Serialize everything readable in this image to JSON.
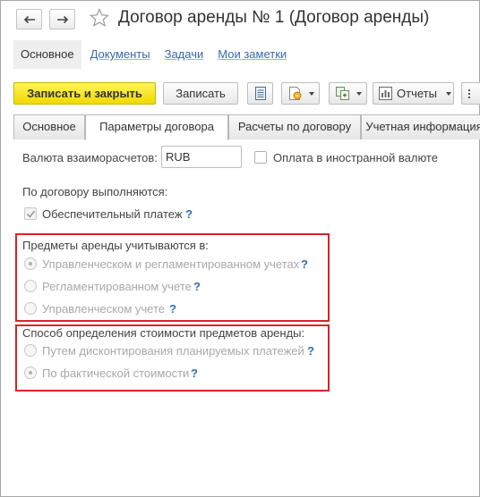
{
  "header": {
    "title": "Договор аренды № 1 (Договор аренды)"
  },
  "panel_nav": {
    "items": [
      "Основное",
      "Документы",
      "Задачи",
      "Мои заметки"
    ]
  },
  "toolbar": {
    "save_close_label": "Записать и закрыть",
    "save_label": "Записать",
    "reports_label": "Отчеты"
  },
  "tabs": [
    "Основное",
    "Параметры договора",
    "Расчеты по договору",
    "Учетная информация"
  ],
  "content": {
    "currency_label": "Валюта взаиморасчетов:",
    "currency_value": "RUB",
    "foreign_currency_label": "Оплата в иностранной валюте",
    "executed_label": "По договору выполняются:",
    "security_payment_label": "Обеспечительный платеж",
    "help_mark": "?",
    "lease_subjects": {
      "title": "Предметы аренды учитываются в:",
      "options": [
        "Управленческом и регламентированном учетах",
        "Регламентированном учете",
        "Управленческом учете"
      ]
    },
    "cost_method": {
      "title": "Способ определения стоимости предметов аренды:",
      "options": [
        "Путем дисконтирования планируемых платежей",
        "По фактической стоимости"
      ]
    }
  },
  "colors": {
    "primary_button": "#f5e000",
    "highlight_border": "#d9232a",
    "link": "#3a68a8",
    "help": "#2f6fb8"
  }
}
